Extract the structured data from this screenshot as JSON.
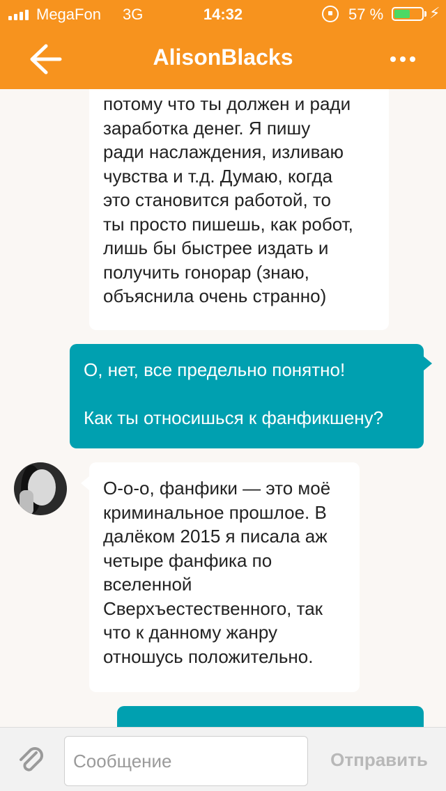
{
  "status_bar": {
    "carrier": "MegaFon",
    "network": "3G",
    "time": "14:32",
    "battery_percent": "57 %",
    "battery_level": 0.57,
    "icons": [
      "signal-icon",
      "orientation-lock-icon",
      "battery-icon",
      "charging-icon"
    ]
  },
  "header": {
    "title": "AlisonBlacks",
    "back_icon": "arrow-left-icon",
    "more_icon": "more-dots-icon"
  },
  "messages": [
    {
      "direction": "incoming",
      "lines": [
        "потому что ты должен и ради",
        "заработка денег. Я пишу",
        "ради наслаждения, изливаю",
        "чувства и т.д. Думаю, когда",
        "это становится работой, то",
        "ты просто пишешь, как робот,",
        "лишь бы быстрее издать и",
        "получить гонорар (знаю,",
        "объяснила очень странно)"
      ]
    },
    {
      "direction": "outgoing",
      "lines": [
        "О, нет, все предельно понятно!",
        "",
        "Как ты относишься к фанфикшену?"
      ]
    },
    {
      "direction": "incoming",
      "lines": [
        "О-о-о, фанфики — это моё",
        "криминальное прошлое. В",
        "далёком 2015 я писала аж",
        "четыре фанфика по",
        "вселенной",
        "Сверхъестественного, так",
        "что к данному жанру",
        "отношусь положительно."
      ]
    },
    {
      "direction": "outgoing",
      "lines": []
    }
  ],
  "composer": {
    "placeholder": "Сообщение",
    "value": "",
    "send_label": "Отправить",
    "attach_icon": "paperclip-icon"
  },
  "colors": {
    "header": "#f7931e",
    "outgoing_bubble": "#00a0b0",
    "incoming_bubble": "#ffffff",
    "background": "#faf7f4"
  }
}
